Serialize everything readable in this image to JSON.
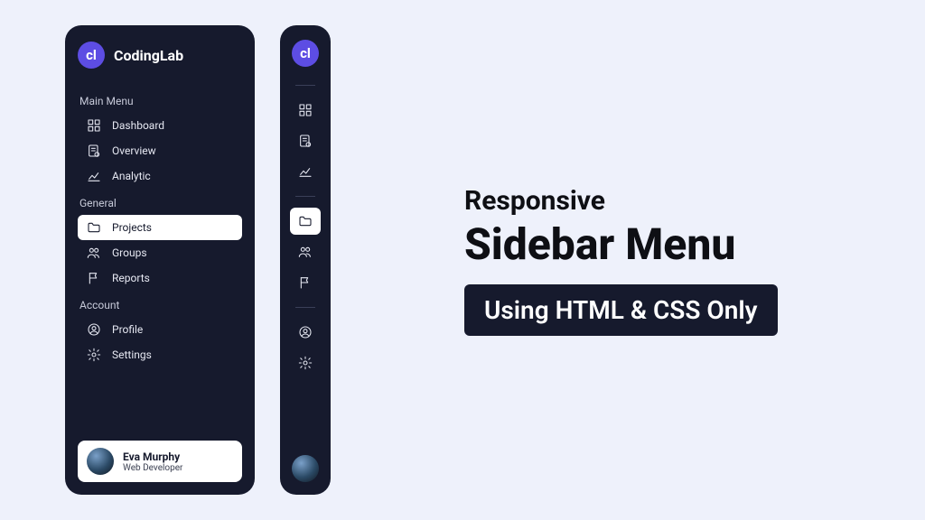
{
  "brand": {
    "logo_text": "cl",
    "name": "CodingLab"
  },
  "sections": {
    "main": {
      "title": "Main Menu",
      "items": [
        {
          "label": "Dashboard",
          "active": false
        },
        {
          "label": "Overview",
          "active": false
        },
        {
          "label": "Analytic",
          "active": false
        }
      ]
    },
    "general": {
      "title": "General",
      "items": [
        {
          "label": "Projects",
          "active": true
        },
        {
          "label": "Groups",
          "active": false
        },
        {
          "label": "Reports",
          "active": false
        }
      ]
    },
    "account": {
      "title": "Account",
      "items": [
        {
          "label": "Profile",
          "active": false
        },
        {
          "label": "Settings",
          "active": false
        }
      ]
    }
  },
  "user": {
    "name": "Eva Murphy",
    "role": "Web Developer"
  },
  "headline": {
    "line1": "Responsive",
    "line2": "Sidebar Menu",
    "badge": "Using HTML & CSS Only"
  },
  "colors": {
    "accent": "#5d4de3",
    "sidebar_bg": "#161a2d",
    "page_bg": "#eef1fb"
  }
}
